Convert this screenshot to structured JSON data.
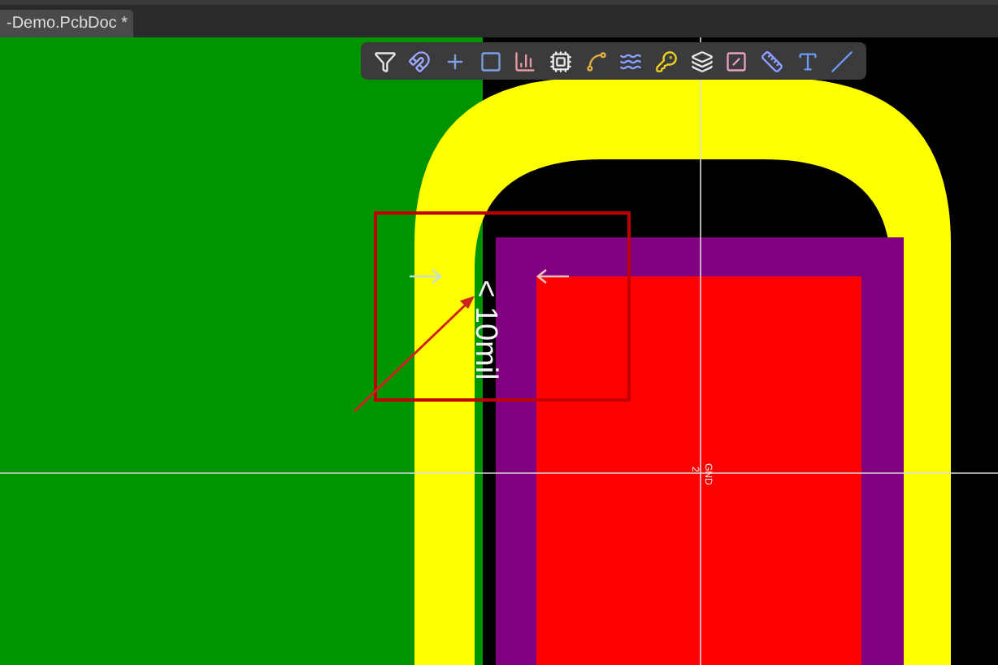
{
  "tabs": [
    {
      "label": "-Demo.PcbDoc *",
      "selected": true
    }
  ],
  "canvas": {
    "clearance_label": "< 10mil",
    "pad_number": "2",
    "pad_net": "GND"
  }
}
